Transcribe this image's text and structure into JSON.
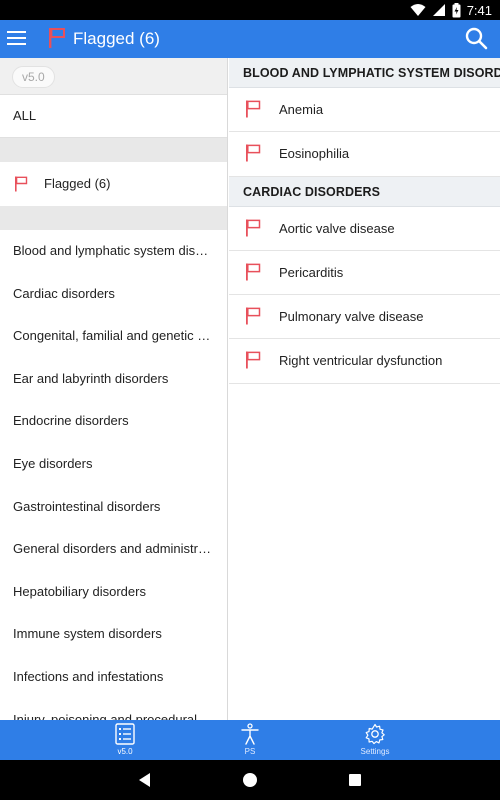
{
  "status_bar": {
    "time": "7:41"
  },
  "app_bar": {
    "title": "Flagged (6)"
  },
  "left_pane": {
    "version_chip": "v5.0",
    "all_label": "ALL",
    "flagged_label": "Flagged (6)",
    "categories": [
      "Blood and lymphatic system disorders",
      "Cardiac disorders",
      "Congenital, familial and genetic disorders",
      "Ear and labyrinth disorders",
      "Endocrine disorders",
      "Eye disorders",
      "Gastrointestinal disorders",
      "General disorders and administration site conditions",
      "Hepatobiliary disorders",
      "Immune system disorders",
      "Infections and infestations",
      "Injury, poisoning and procedural complications"
    ]
  },
  "right_pane": {
    "sections": [
      {
        "header": "BLOOD AND LYMPHATIC SYSTEM DISORDERS",
        "items": [
          "Anemia",
          "Eosinophilia"
        ]
      },
      {
        "header": "CARDIAC DISORDERS",
        "items": [
          "Aortic valve disease",
          "Pericarditis",
          "Pulmonary valve disease",
          "Right ventricular dysfunction"
        ]
      }
    ]
  },
  "bottom_nav": {
    "tabs": [
      {
        "label": "v5.0",
        "icon": "list-icon",
        "active": true
      },
      {
        "label": "PS",
        "icon": "person-icon",
        "active": false
      },
      {
        "label": "Settings",
        "icon": "gear-icon",
        "active": false
      }
    ]
  },
  "colors": {
    "primary": "#2f7ee7",
    "flag": "#e8505b"
  }
}
